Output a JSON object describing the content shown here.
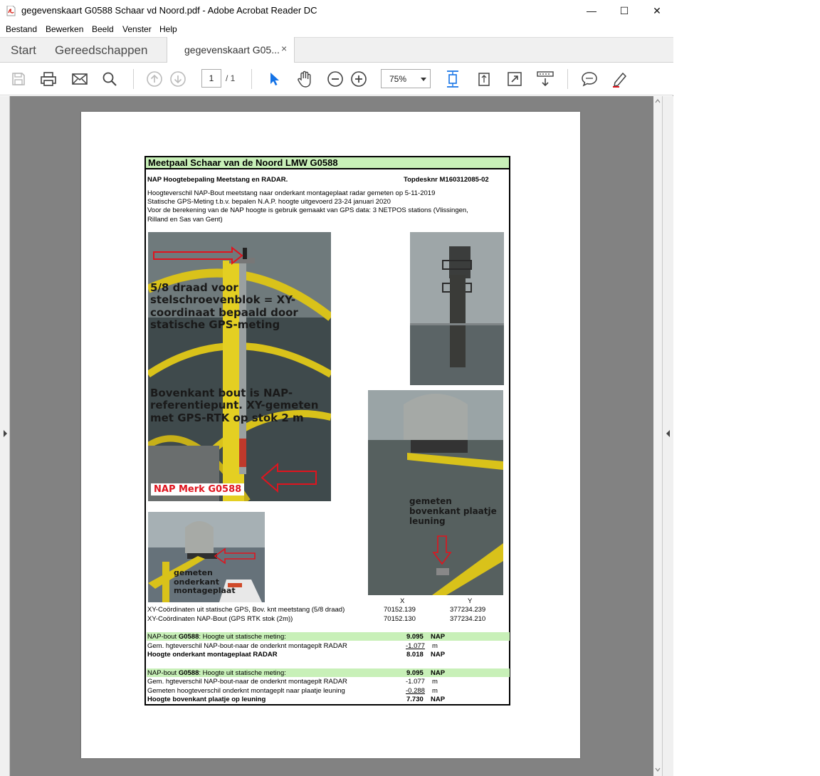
{
  "window": {
    "title": "gegevenskaart G0588 Schaar vd Noord.pdf - Adobe Acrobat Reader DC",
    "minimize_glyph": "—",
    "maximize_glyph": "☐",
    "close_glyph": "✕"
  },
  "menu": {
    "items": [
      "Bestand",
      "Bewerken",
      "Beeld",
      "Venster",
      "Help"
    ]
  },
  "tabs": {
    "start": "Start",
    "tools": "Gereedschappen",
    "doc": "gegevenskaart G05...",
    "doc_close": "×"
  },
  "toolbar": {
    "page_current": "1",
    "page_total": "/ 1",
    "zoom": "75%"
  },
  "document": {
    "header": "Meetpaal Schaar van de Noord LMW G0588",
    "subtitle": "NAP Hoogtebepaling Meetstang en RADAR.",
    "topdesk": "Topdesknr M160312085-02",
    "info_lines": [
      "Hoogteverschil NAP-Bout meetstang naar onderkant montageplaat radar gemeten op 5-11-2019",
      "Statische GPS-Meting t.b.v. bepalen N.A.P. hoogte uitgevoerd 23-24 januari 2020",
      "Voor de berekening van de NAP hoogte is gebruik gemaakt van GPS data: 3 NETPOS stations (Vlissingen,",
      "Rilland en Sas van Gent)"
    ],
    "photo1": {
      "caption1": "5/8 draad voor stelschroevenblok = XY-coordinaat bepaald door statische GPS-meting",
      "caption2": "Bovenkant bout is NAP-referentiepunt. XY-gemeten met GPS-RTK op stok 2 m",
      "label": "NAP Merk G0588"
    },
    "photo3_caption": "gemeten bovenkant plaatje leuning",
    "photo4_caption": "gemeten onderkant montageplaat",
    "xy_header_x": "X",
    "xy_header_y": "Y",
    "xy_rows": [
      {
        "label": "XY-Coördinaten uit statische GPS, Bov. knt meetstang (5/8 draad)",
        "x": "70152.139",
        "y": "377234.239"
      },
      {
        "label": "XY-Coördinaten NAP-Bout (GPS RTK stok (2m))",
        "x": "70152.130",
        "y": "377234.210"
      }
    ],
    "calc1": {
      "row1_label_pre": "NAP-bout ",
      "row1_label_bold": "G0588",
      "row1_label_post": ": Hoogte uit statische meting:",
      "row1_value": "9.095",
      "row1_unit": "NAP",
      "row2_label": "Gem. hgteverschil NAP-bout-naar de onderknt montageplt RADAR",
      "row2_value": "-1.077",
      "row2_unit": "m",
      "row3_label": "Hoogte onderkant montageplaat RADAR",
      "row3_value": "8.018",
      "row3_unit": "NAP"
    },
    "calc2": {
      "row1_label_pre": "NAP-bout ",
      "row1_label_bold": "G0588",
      "row1_label_post": ": Hoogte uit statische meting:",
      "row1_value": "9.095",
      "row1_unit": "NAP",
      "row2_label": "Gem. hgteverschil NAP-bout-naar de onderknt montageplt RADAR",
      "row2_value": "-1.077",
      "row2_unit": "m",
      "row3_label": "Gemeten hoogteverschil onderknt montageplt naar plaatje leuning",
      "row3_value": "-0.288",
      "row3_unit": "m",
      "row4_label": "Hoogte bovenkant plaatje op leuning",
      "row4_value": "7.730",
      "row4_unit": "NAP"
    }
  },
  "colors": {
    "header_green": "#c8f0b8",
    "viewer_gray": "#828282",
    "accent_blue": "#1473e6",
    "nap_red": "#e0141e"
  }
}
